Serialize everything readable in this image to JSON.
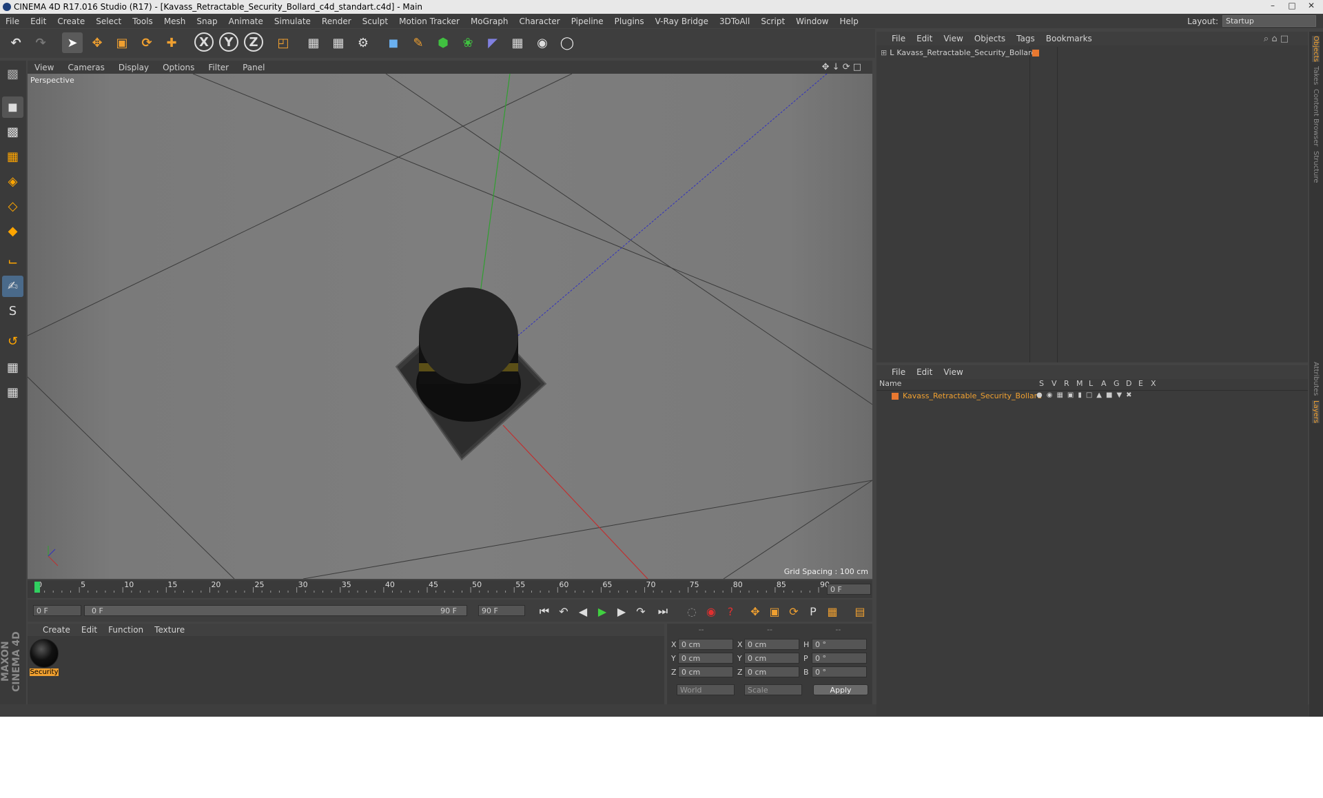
{
  "window": {
    "title": "CINEMA 4D R17.016 Studio (R17) - [Kavass_Retractable_Security_Bollard_c4d_standart.c4d] - Main"
  },
  "menubar": {
    "items": [
      "File",
      "Edit",
      "Create",
      "Select",
      "Tools",
      "Mesh",
      "Snap",
      "Animate",
      "Simulate",
      "Render",
      "Sculpt",
      "Motion Tracker",
      "MoGraph",
      "Character",
      "Pipeline",
      "Plugins",
      "V-Ray Bridge",
      "3DToAll",
      "Script",
      "Window",
      "Help"
    ],
    "layout_label": "Layout:",
    "layout_value": "Startup"
  },
  "viewport": {
    "menu": [
      "View",
      "Cameras",
      "Display",
      "Options",
      "Filter",
      "Panel"
    ],
    "label": "Perspective",
    "grid_spacing": "Grid Spacing : 100 cm"
  },
  "timeline": {
    "ticks": [
      "0",
      "5",
      "10",
      "15",
      "20",
      "25",
      "30",
      "35",
      "40",
      "45",
      "50",
      "55",
      "60",
      "65",
      "70",
      "75",
      "80",
      "85",
      "90"
    ],
    "frame_display": "0 F",
    "start_frame": "0 F",
    "range_start": "0 F",
    "range_end": "90 F",
    "end_frame": "90 F"
  },
  "material_panel": {
    "menu": [
      "Create",
      "Edit",
      "Function",
      "Texture"
    ],
    "material_name": "Security"
  },
  "coordinates": {
    "headers": [
      "--",
      "--",
      "--"
    ],
    "rows": [
      {
        "a": "X",
        "av": "0 cm",
        "b": "X",
        "bv": "0 cm",
        "c": "H",
        "cv": "0 °"
      },
      {
        "a": "Y",
        "av": "0 cm",
        "b": "Y",
        "bv": "0 cm",
        "c": "P",
        "cv": "0 °"
      },
      {
        "a": "Z",
        "av": "0 cm",
        "b": "Z",
        "bv": "0 cm",
        "c": "B",
        "cv": "0 °"
      }
    ],
    "mode": "World",
    "scale": "Scale",
    "apply": "Apply"
  },
  "object_manager": {
    "menu": [
      "File",
      "Edit",
      "View",
      "Objects",
      "Tags",
      "Bookmarks"
    ],
    "object_name": "Kavass_Retractable_Security_Bollard"
  },
  "layer_manager": {
    "menu": [
      "File",
      "Edit",
      "View"
    ],
    "columns": [
      "Name",
      "S",
      "V",
      "R",
      "M",
      "L",
      "A",
      "G",
      "D",
      "E",
      "X"
    ],
    "layer_name": "Kavass_Retractable_Security_Bollard"
  },
  "right_tabs": [
    "Objects",
    "Takes",
    "Content Browser",
    "Structure",
    "Attributes",
    "Layers"
  ],
  "branding": "MAXON CINEMA 4D",
  "colors": {
    "accent": "#f0a030",
    "layer_orange": "#e87830",
    "x_axis": "#c03030",
    "y_axis": "#30a030",
    "z_axis": "#3030c0"
  }
}
